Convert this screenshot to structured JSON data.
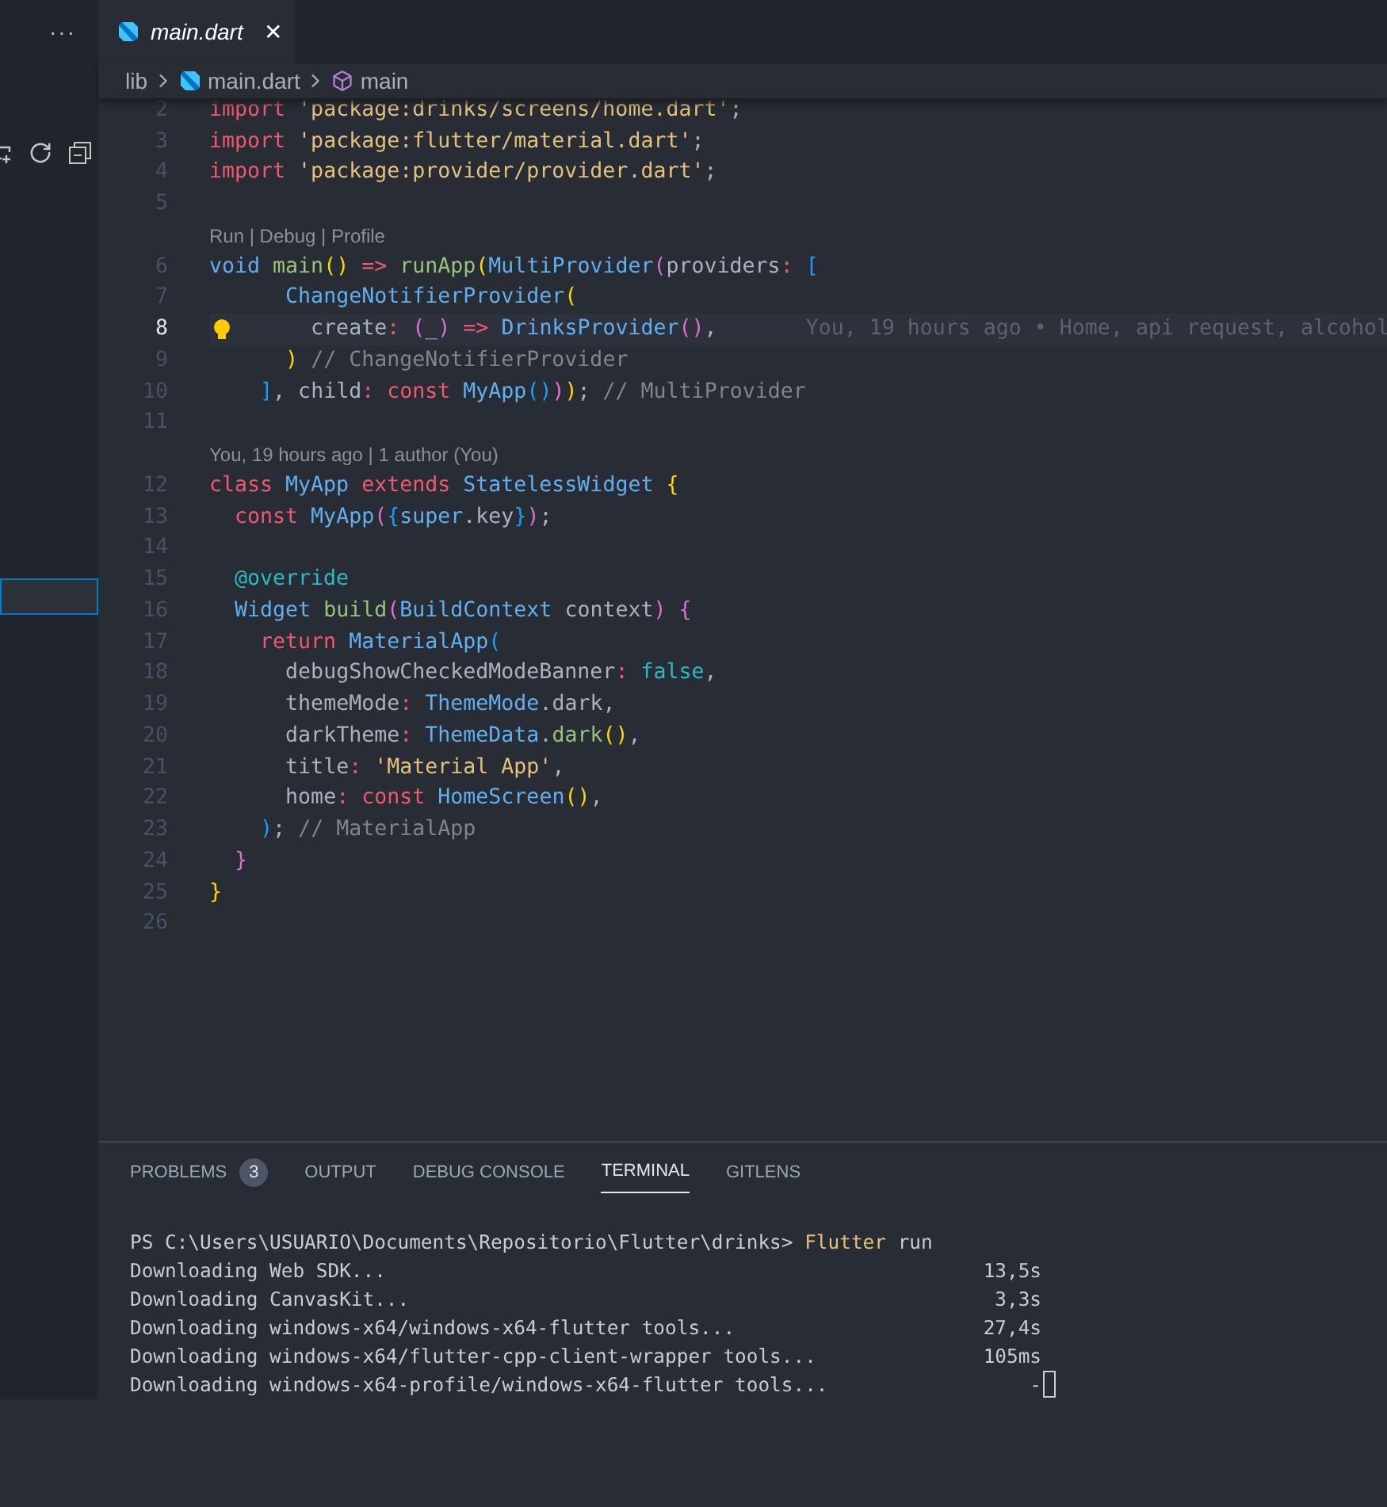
{
  "explorer": {
    "more": "···",
    "items": [
      {
        "selected": true
      }
    ]
  },
  "tabs": [
    {
      "label": "main.dart",
      "selected": true,
      "close": "✕"
    }
  ],
  "breadcrumbs": [
    {
      "label": "lib",
      "kind": "folder"
    },
    {
      "label": "main.dart",
      "kind": "file"
    },
    {
      "label": "main",
      "kind": "symbol"
    }
  ],
  "code_lines": [
    {
      "kind": "code",
      "number": "2",
      "current": false,
      "tokens": [
        {
          "kind": "kw",
          "text": "import"
        },
        {
          "kind": "str",
          "text": " 'package:drinks/screens/home.dart'"
        },
        {
          "kind": "plain",
          "text": ";"
        }
      ]
    },
    {
      "kind": "code",
      "number": "3",
      "current": false,
      "tokens": [
        {
          "kind": "kw",
          "text": "import"
        },
        {
          "kind": "str",
          "text": " 'package:flutter/material.dart'"
        },
        {
          "kind": "plain",
          "text": ";"
        }
      ]
    },
    {
      "kind": "code",
      "number": "4",
      "current": false,
      "tokens": [
        {
          "kind": "kw",
          "text": "import"
        },
        {
          "kind": "str",
          "text": " 'package:provider/provider.dart'"
        },
        {
          "kind": "plain",
          "text": ";"
        }
      ]
    },
    {
      "kind": "code",
      "number": "5",
      "current": false
    },
    {
      "kind": "codelens",
      "text": "Run | Debug | Profile"
    },
    {
      "kind": "code",
      "number": "6",
      "current": false,
      "tokens": [
        {
          "kind": "type",
          "text": "void"
        },
        {
          "kind": "fn",
          "text": " main"
        },
        {
          "kind": "b1",
          "text": "()"
        },
        {
          "kind": "op",
          "text": " =>"
        },
        {
          "kind": "fn",
          "text": " runApp"
        },
        {
          "kind": "b1",
          "text": "("
        },
        {
          "kind": "type",
          "text": "MultiProvider"
        },
        {
          "kind": "b2",
          "text": "("
        },
        {
          "kind": "plain",
          "text": "providers"
        },
        {
          "kind": "op",
          "text": ":"
        },
        {
          "kind": "b3",
          "text": " ["
        }
      ]
    },
    {
      "kind": "code",
      "number": "7",
      "current": false,
      "tokens": [
        {
          "kind": "type",
          "text": "      ChangeNotifierProvider"
        },
        {
          "kind": "b1",
          "text": "("
        }
      ]
    },
    {
      "kind": "code",
      "number": "8",
      "current": true,
      "blame": "You, 19 hours ago • Home, api request, alcohol",
      "tokens": [
        {
          "kind": "plain",
          "text": "        create"
        },
        {
          "kind": "op",
          "text": ":"
        },
        {
          "kind": "b2",
          "text": " ("
        },
        {
          "kind": "plain",
          "text": "_"
        },
        {
          "kind": "b2",
          "text": ")"
        },
        {
          "kind": "op",
          "text": " =>"
        },
        {
          "kind": "type",
          "text": " DrinksProvider"
        },
        {
          "kind": "b2",
          "text": "()"
        },
        {
          "kind": "plain",
          "text": ","
        }
      ]
    },
    {
      "kind": "code",
      "number": "9",
      "current": false,
      "tokens": [
        {
          "kind": "b1",
          "text": "      )"
        },
        {
          "kind": "comment",
          "text": " // ChangeNotifierProvider"
        }
      ]
    },
    {
      "kind": "code",
      "number": "10",
      "current": false,
      "tokens": [
        {
          "kind": "b3",
          "text": "    ]"
        },
        {
          "kind": "plain",
          "text": ", child"
        },
        {
          "kind": "op",
          "text": ":"
        },
        {
          "kind": "kw",
          "text": " const"
        },
        {
          "kind": "type",
          "text": " MyApp"
        },
        {
          "kind": "b3",
          "text": "()"
        },
        {
          "kind": "b2",
          "text": ")"
        },
        {
          "kind": "b1",
          "text": ")"
        },
        {
          "kind": "plain",
          "text": ";"
        },
        {
          "kind": "comment",
          "text": " // MultiProvider"
        }
      ]
    },
    {
      "kind": "code",
      "number": "11",
      "current": false
    },
    {
      "kind": "codelens",
      "text": "You, 19 hours ago | 1 author (You)"
    },
    {
      "kind": "code",
      "number": "12",
      "current": false,
      "tokens": [
        {
          "kind": "kw",
          "text": "class"
        },
        {
          "kind": "type",
          "text": " MyApp"
        },
        {
          "kind": "kw",
          "text": " extends"
        },
        {
          "kind": "type",
          "text": " StatelessWidget"
        },
        {
          "kind": "b1",
          "text": " {"
        }
      ]
    },
    {
      "kind": "code",
      "number": "13",
      "current": false,
      "tokens": [
        {
          "kind": "kw",
          "text": "  const"
        },
        {
          "kind": "type",
          "text": " MyApp"
        },
        {
          "kind": "b2",
          "text": "("
        },
        {
          "kind": "b3",
          "text": "{"
        },
        {
          "kind": "type",
          "text": "super"
        },
        {
          "kind": "plain",
          "text": ".key"
        },
        {
          "kind": "b3",
          "text": "}"
        },
        {
          "kind": "b2",
          "text": ")"
        },
        {
          "kind": "plain",
          "text": ";"
        }
      ]
    },
    {
      "kind": "code",
      "number": "14",
      "current": false
    },
    {
      "kind": "code",
      "number": "15",
      "current": false,
      "tokens": [
        {
          "kind": "const",
          "text": "  @override"
        }
      ]
    },
    {
      "kind": "code",
      "number": "16",
      "current": false,
      "tokens": [
        {
          "kind": "type",
          "text": "  Widget"
        },
        {
          "kind": "fn",
          "text": " build"
        },
        {
          "kind": "b2",
          "text": "("
        },
        {
          "kind": "type",
          "text": "BuildContext"
        },
        {
          "kind": "plain",
          "text": " context"
        },
        {
          "kind": "b2",
          "text": ")"
        },
        {
          "kind": "b2",
          "text": " {"
        }
      ]
    },
    {
      "kind": "code",
      "number": "17",
      "current": false,
      "tokens": [
        {
          "kind": "kw",
          "text": "    return"
        },
        {
          "kind": "type",
          "text": " MaterialApp"
        },
        {
          "kind": "b3",
          "text": "("
        }
      ]
    },
    {
      "kind": "code",
      "number": "18",
      "current": false,
      "tokens": [
        {
          "kind": "plain",
          "text": "      debugShowCheckedModeBanner"
        },
        {
          "kind": "op",
          "text": ":"
        },
        {
          "kind": "const",
          "text": " false"
        },
        {
          "kind": "plain",
          "text": ","
        }
      ]
    },
    {
      "kind": "code",
      "number": "19",
      "current": false,
      "tokens": [
        {
          "kind": "plain",
          "text": "      themeMode"
        },
        {
          "kind": "op",
          "text": ":"
        },
        {
          "kind": "type",
          "text": " ThemeMode"
        },
        {
          "kind": "plain",
          "text": ".dark,"
        }
      ]
    },
    {
      "kind": "code",
      "number": "20",
      "current": false,
      "tokens": [
        {
          "kind": "plain",
          "text": "      darkTheme"
        },
        {
          "kind": "op",
          "text": ":"
        },
        {
          "kind": "type",
          "text": " ThemeData"
        },
        {
          "kind": "plain",
          "text": "."
        },
        {
          "kind": "fn",
          "text": "dark"
        },
        {
          "kind": "b1",
          "text": "()"
        },
        {
          "kind": "plain",
          "text": ","
        }
      ]
    },
    {
      "kind": "code",
      "number": "21",
      "current": false,
      "tokens": [
        {
          "kind": "plain",
          "text": "      title"
        },
        {
          "kind": "op",
          "text": ":"
        },
        {
          "kind": "str",
          "text": " 'Material App'"
        },
        {
          "kind": "plain",
          "text": ","
        }
      ]
    },
    {
      "kind": "code",
      "number": "22",
      "current": false,
      "tokens": [
        {
          "kind": "plain",
          "text": "      home"
        },
        {
          "kind": "op",
          "text": ":"
        },
        {
          "kind": "kw",
          "text": " const"
        },
        {
          "kind": "type",
          "text": " HomeScreen"
        },
        {
          "kind": "b1",
          "text": "()"
        },
        {
          "kind": "plain",
          "text": ","
        }
      ]
    },
    {
      "kind": "code",
      "number": "23",
      "current": false,
      "tokens": [
        {
          "kind": "b3",
          "text": "    )"
        },
        {
          "kind": "plain",
          "text": ";"
        },
        {
          "kind": "comment",
          "text": " // MaterialApp"
        }
      ]
    },
    {
      "kind": "code",
      "number": "24",
      "current": false,
      "tokens": [
        {
          "kind": "b2",
          "text": "  }"
        }
      ]
    },
    {
      "kind": "code",
      "number": "25",
      "current": false,
      "tokens": [
        {
          "kind": "b1",
          "text": "}"
        }
      ]
    },
    {
      "kind": "code",
      "number": "26",
      "current": false
    }
  ],
  "panel": {
    "tabs": [
      {
        "label": "PROBLEMS",
        "selected": false,
        "badge": "3"
      },
      {
        "label": "OUTPUT",
        "selected": false
      },
      {
        "label": "DEBUG CONSOLE",
        "selected": false
      },
      {
        "label": "TERMINAL",
        "selected": true
      },
      {
        "label": "GITLENS",
        "selected": false
      }
    ],
    "terminal": {
      "prompt": "PS C:\\Users\\USUARIO\\Documents\\Repositorio\\Flutter\\drinks>",
      "command": "Flutter",
      "args": "run",
      "lines": [
        {
          "text": "Downloading Web SDK...",
          "time": "13,5s",
          "cursor": false
        },
        {
          "text": "Downloading CanvasKit...",
          "time": "3,3s",
          "cursor": false
        },
        {
          "text": "Downloading windows-x64/windows-x64-flutter tools...",
          "time": "27,4s",
          "cursor": false
        },
        {
          "text": "Downloading windows-x64/flutter-cpp-client-wrapper tools...",
          "time": "105ms",
          "cursor": false
        },
        {
          "text": "Downloading windows-x64-profile/windows-x64-flutter tools...",
          "time": "-",
          "cursor": true
        }
      ]
    }
  }
}
